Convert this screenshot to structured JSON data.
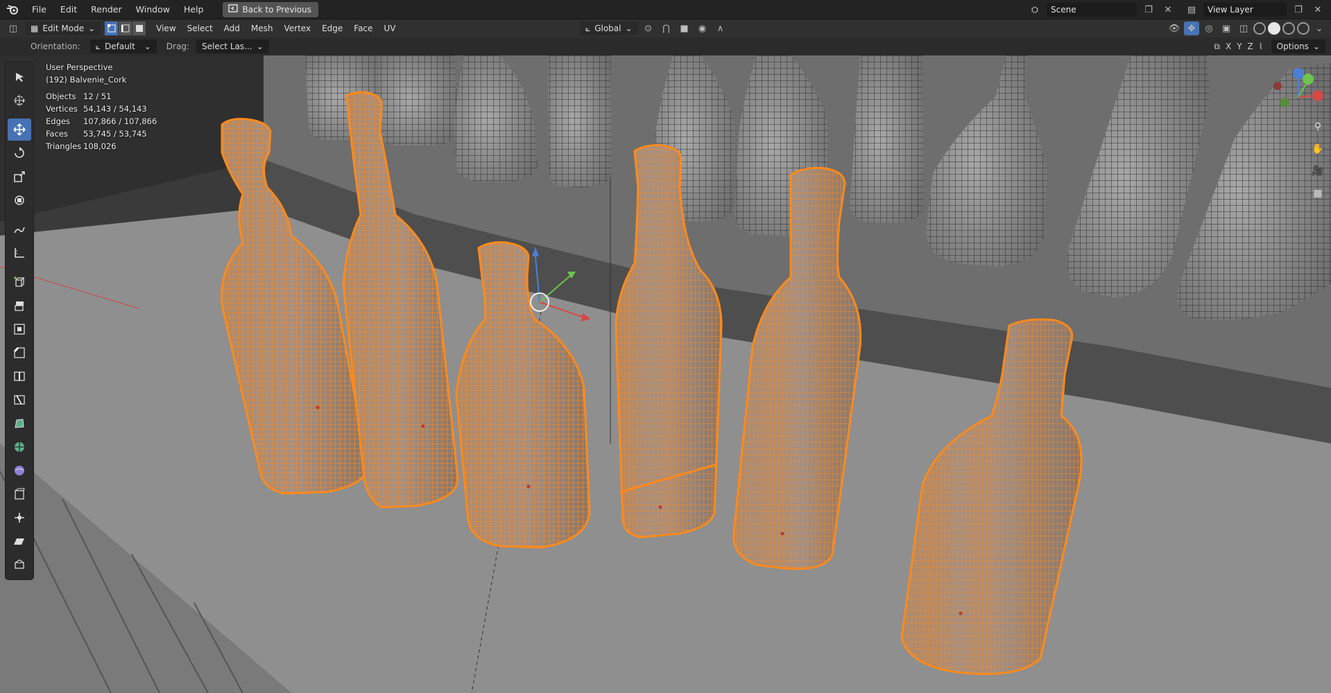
{
  "menu": {
    "items": [
      "File",
      "Edit",
      "Render",
      "Window",
      "Help"
    ],
    "back_label": "Back to Previous"
  },
  "scene_field": "Scene",
  "view_layer_field": "View Layer",
  "header": {
    "mode": "Edit Mode",
    "menus": [
      "View",
      "Select",
      "Add",
      "Mesh",
      "Vertex",
      "Edge",
      "Face",
      "UV"
    ],
    "transform_orientation": "Global",
    "options": "Options"
  },
  "toolsettings": {
    "orientation_label": "Orientation:",
    "orientation_value": "Default",
    "drag_label": "Drag:",
    "drag_value": "Select Las...",
    "axes": [
      "X",
      "Y",
      "Z"
    ]
  },
  "overlay": {
    "view_name": "User Perspective",
    "object_name": "(192) Balvenie_Cork",
    "stats": [
      {
        "key": "Objects",
        "value": "12 / 51"
      },
      {
        "key": "Vertices",
        "value": "54,143 / 54,143"
      },
      {
        "key": "Edges",
        "value": "107,866 / 107,866"
      },
      {
        "key": "Faces",
        "value": "53,745 / 53,745"
      },
      {
        "key": "Triangles",
        "value": "108,026"
      }
    ]
  },
  "colors": {
    "selected": "#ff8a1c",
    "active_tool": "#4772b3",
    "mesh_wire": "#2b2b2b",
    "floor": "#8f8f8f"
  },
  "icons": {
    "toolbar": [
      "select-box-icon",
      "cursor-icon",
      "move-icon",
      "rotate-icon",
      "scale-icon",
      "transform-icon",
      "annotate-icon",
      "measure-icon",
      "add-cube-icon",
      "extrude-icon",
      "inset-icon",
      "bevel-icon",
      "loop-cut-icon",
      "knife-icon",
      "poly-build-icon",
      "spin-icon",
      "smooth-icon",
      "edge-slide-icon",
      "shrink-fatten-icon",
      "shear-icon",
      "rip-icon"
    ]
  }
}
